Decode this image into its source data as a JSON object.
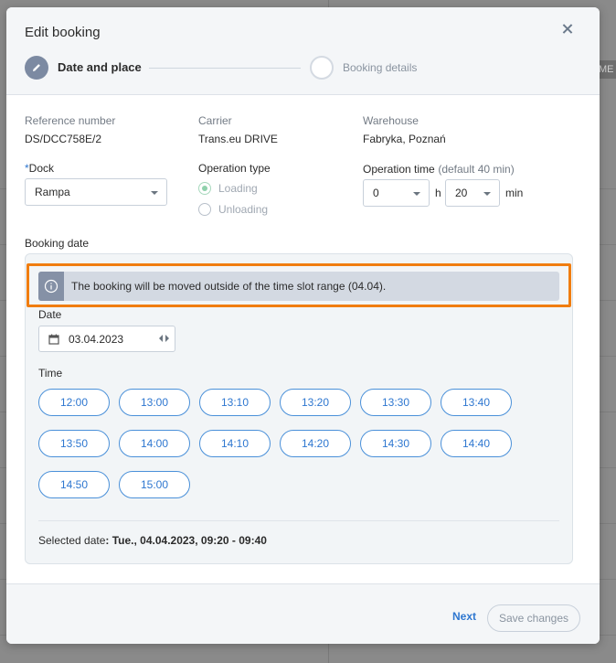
{
  "background": {
    "tab_fragment": "ME"
  },
  "modal": {
    "title": "Edit booking",
    "steps": [
      {
        "label": "Date and place",
        "active": true
      },
      {
        "label": "Booking details",
        "active": false
      }
    ]
  },
  "info": {
    "reference": {
      "label": "Reference number",
      "value": "DS/DCC758E/2"
    },
    "carrier": {
      "label": "Carrier",
      "value": "Trans.eu DRIVE"
    },
    "warehouse": {
      "label": "Warehouse",
      "value": "Fabryka, Poznań"
    }
  },
  "dock": {
    "required_mark": "*",
    "label": "Dock",
    "value": "Rampa"
  },
  "operation_type": {
    "label": "Operation type",
    "options": [
      {
        "label": "Loading",
        "selected": true,
        "disabled": true
      },
      {
        "label": "Unloading",
        "selected": false,
        "disabled": true
      }
    ]
  },
  "operation_time": {
    "label": "Operation time",
    "hint": "(default 40 min)",
    "hours": "0",
    "hours_unit": "h",
    "minutes": "20",
    "minutes_unit": "min"
  },
  "booking_date": {
    "label": "Booking date",
    "alert": "The booking will be moved outside of the time slot range (04.04).",
    "date_label": "Date",
    "date_value": "03.04.2023",
    "time_label": "Time",
    "slots": [
      "12:00",
      "13:00",
      "13:10",
      "13:20",
      "13:30",
      "13:40",
      "13:50",
      "14:00",
      "14:10",
      "14:20",
      "14:30",
      "14:40",
      "14:50",
      "15:00"
    ],
    "selected_prefix": "Selected date",
    "selected_value": ": Tue., 04.04.2023, 09:20 - 09:40"
  },
  "footer": {
    "next": "Next",
    "save": "Save changes"
  },
  "colors": {
    "accent": "#2e77d0",
    "alert_border": "#f07d10",
    "step_active": "#7c8aa2"
  }
}
